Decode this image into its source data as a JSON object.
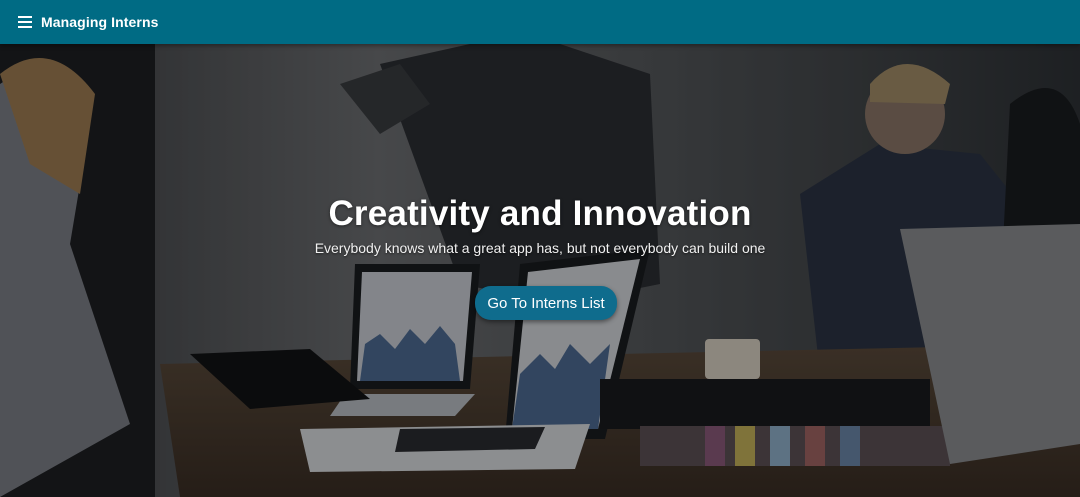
{
  "app_bar": {
    "title": "Managing Interns",
    "menu_icon": "menu-icon",
    "color": "#006b84"
  },
  "hero": {
    "heading": "Creativity and Innovation",
    "subheading": "Everybody knows what a great app has, but not everybody can build one",
    "cta_label": "Go To Interns List",
    "cta_color": "#0f6c8d",
    "background_image": "office-meeting-photo"
  }
}
